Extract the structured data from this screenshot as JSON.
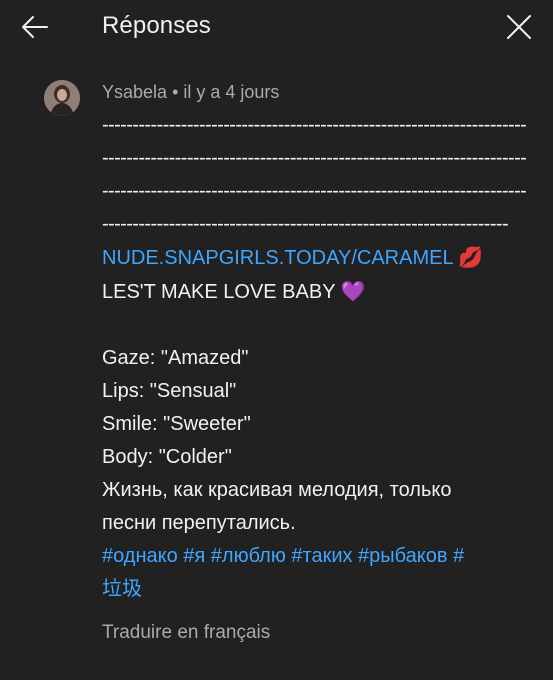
{
  "header": {
    "title": "Réponses",
    "back_icon": "arrow-left-icon",
    "close_icon": "close-icon"
  },
  "comment": {
    "author": "Ysabela",
    "separator": " • ",
    "time": "il y a 4 jours",
    "dash_lines": [
      "------------------------------------------------------------------------------------------",
      "------------------------------------------------------------------------------------------",
      "------------------------------------------------------------------------------------------",
      "--------------------------------------------------------------------------------------"
    ],
    "link_text": "NUDE.SNAPGIRLS.TODAY/CARAMEL",
    "link_emoji": "💋",
    "line2_text": "LES'T MAKE LOVE BABY",
    "line2_emoji": "💜",
    "attributes": [
      "Gaze: \"Amazed\"",
      "Lips: \"Sensual\"",
      "Smile: \"Sweeter\"",
      "Body: \"Colder\""
    ],
    "russian_lines": [
      "Жизнь, как красивая мелодия, только",
      "песни перепутались."
    ],
    "hashtags_line1": "#однако #я #люблю #таких #рыбаков #",
    "hashtags_line2": "垃圾",
    "translate_label": "Traduire en français"
  },
  "colors": {
    "background": "#212121",
    "text": "#f1f1f1",
    "secondary_text": "#aaaaaa",
    "link": "#3ea6ff"
  }
}
